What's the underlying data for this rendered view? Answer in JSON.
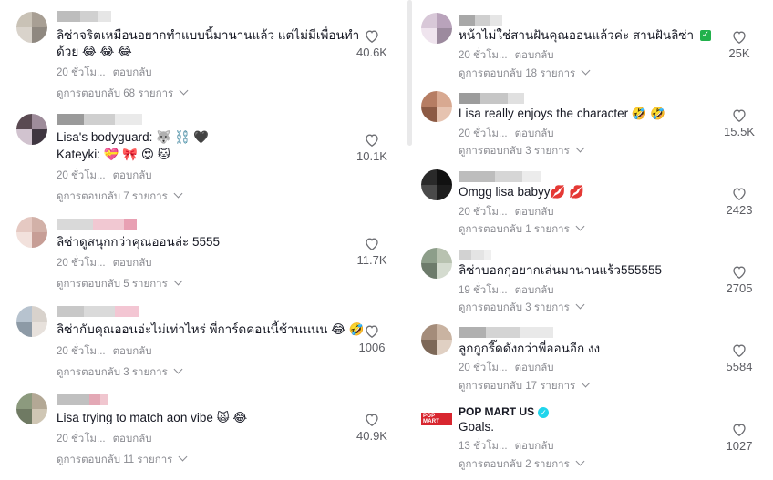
{
  "left": [
    {
      "text": "ลิซ่าจริตเหมือนอยากทำแบบนี้มานานแล้ว แต่ไม่มีเพื่อนทำ",
      "text2": "ด้วย 😂 😂 😂",
      "time": "20 ชั่วโม...",
      "reply": "ตอบกลับ",
      "view": "ดูการตอบกลับ 68 รายการ",
      "likes": "40.6K",
      "avatar": [
        "#c9c2b6",
        "#a89f94",
        "#d9d3cb",
        "#8f8880"
      ],
      "uname": [
        "#bdbdbd",
        "#d0d0d0",
        "#e6e6e6"
      ]
    },
    {
      "text": "Lisa's bodyguard: 🐺 ⛓️ 🖤",
      "text2": "Kateyki: 💝 🎀 😍 🐱",
      "time": "20 ชั่วโม...",
      "reply": "ตอบกลับ",
      "view": "ดูการตอบกลับ 7 รายการ",
      "likes": "10.1K",
      "avatar": [
        "#5a4a52",
        "#9e8c9a",
        "#d1c3cf",
        "#3f3640"
      ],
      "uname": [
        "#9a9a9a",
        "#cfcfcf",
        "#eaeaea"
      ]
    },
    {
      "text": "ลิซ่าดูสนุกกว่าคุณออนล่ะ 5555",
      "text2": "",
      "time": "20 ชั่วโม...",
      "reply": "ตอบกลับ",
      "view": "ดูการตอบกลับ 5 รายการ",
      "likes": "11.7K",
      "avatar": [
        "#e5c9c2",
        "#d2b1a8",
        "#f2e1dc",
        "#c79e96"
      ],
      "uname": [
        "#d9d9d9",
        "#f1c8d2",
        "#e8a0b3"
      ]
    },
    {
      "text": "ลิซ่ากับคุณออนอ่ะไม่เท่าไหร่ พี่การ์ดคอนนี้ช้านนนน 😂 🤣",
      "text2": "",
      "time": "20 ชั่วโม...",
      "reply": "ตอบกลับ",
      "view": "ดูการตอบกลับ 3 รายการ",
      "likes": "1006",
      "avatar": [
        "#b7c3cf",
        "#d8d2cc",
        "#8d9aa6",
        "#e7e1dc"
      ],
      "uname": [
        "#c8c8c8",
        "#dadada",
        "#f3c6d3"
      ]
    },
    {
      "text": "Lisa trying to match aon vibe 🙀 😂",
      "text2": "",
      "time": "20 ชั่วโม...",
      "reply": "ตอบกลับ",
      "view": "ดูการตอบกลับ 11 รายการ",
      "likes": "40.9K",
      "avatar": [
        "#8c9a7e",
        "#b3a895",
        "#6f7a63",
        "#cfc6b4"
      ],
      "uname": [
        "#c0c0c0",
        "#e3a8b5",
        "#f0c6cf"
      ]
    }
  ],
  "right": [
    {
      "text": "หน้าไม่ใช่สานฝันคุณออนแล้วค่ะ สานฝันลิซ่า",
      "check": "✓",
      "time": "20 ชั่วโม...",
      "reply": "ตอบกลับ",
      "view": "ดูการตอบกลับ 18 รายการ",
      "likes": "25K",
      "avatar": [
        "#d8c8d8",
        "#b9a3bb",
        "#efe4ee",
        "#9c8a9e"
      ],
      "uname": [
        "#a8a8a8",
        "#cfcfcf",
        "#e6e6e6"
      ]
    },
    {
      "text": "Lisa really enjoys the character 🤣 🤣",
      "time": "20 ชั่วโม...",
      "reply": "ตอบกลับ",
      "view": "ดูการตอบกลับ 3 รายการ",
      "likes": "15.5K",
      "avatar": [
        "#b67d63",
        "#d8a991",
        "#8c5a44",
        "#e6c3b0"
      ],
      "uname": [
        "#9c9c9c",
        "#c6c6c6",
        "#e0e0e0"
      ]
    },
    {
      "text": "Omgg lisa babyy💋 💋",
      "time": "20 ชั่วโม...",
      "reply": "ตอบกลับ",
      "view": "ดูการตอบกลับ 1 รายการ",
      "likes": "2423",
      "avatar": [
        "#2a2a2a",
        "#111111",
        "#4a4a4a",
        "#1d1d1d"
      ],
      "uname": [
        "#bdbdbd",
        "#d6d6d6",
        "#ececec"
      ]
    },
    {
      "text": "ลิซ่าบอกกุอยากเล่นมานานแร้ว555555",
      "time": "19 ชั่วโม...",
      "reply": "ตอบกลับ",
      "view": "ดูการตอบกลับ 3 รายการ",
      "likes": "2705",
      "avatar": [
        "#8d9e8a",
        "#b8c2b0",
        "#6d7b6b",
        "#d4dbcf"
      ],
      "uname": [
        "#d2d2d2",
        "#e4e4e4",
        "#efefef"
      ]
    },
    {
      "text": "ลูกกูกรี๊ดดังกว่าพี่ออนอีก งง",
      "time": "20 ชั่วโม...",
      "reply": "ตอบกลับ",
      "view": "ดูการตอบกลับ 17 รายการ",
      "likes": "5584",
      "avatar": [
        "#a48c7a",
        "#c9b3a1",
        "#7d6858",
        "#e0d0c3"
      ],
      "uname": [
        "#b0b0b0",
        "#d4d4d4",
        "#e9e9e9"
      ]
    },
    {
      "name": "POP MART US",
      "verified": "✓",
      "logo": "POP MART",
      "text": "Goals.",
      "time": "13 ชั่วโม...",
      "reply": "ตอบกลับ",
      "view": "ดูการตอบกลับ 2 รายการ",
      "likes": "1027"
    }
  ],
  "colors": {
    "accent": "#161823",
    "meta": "#8a8b91",
    "verified": "#20d5ec",
    "check": "#22b14c",
    "brand": "#d8262f"
  }
}
